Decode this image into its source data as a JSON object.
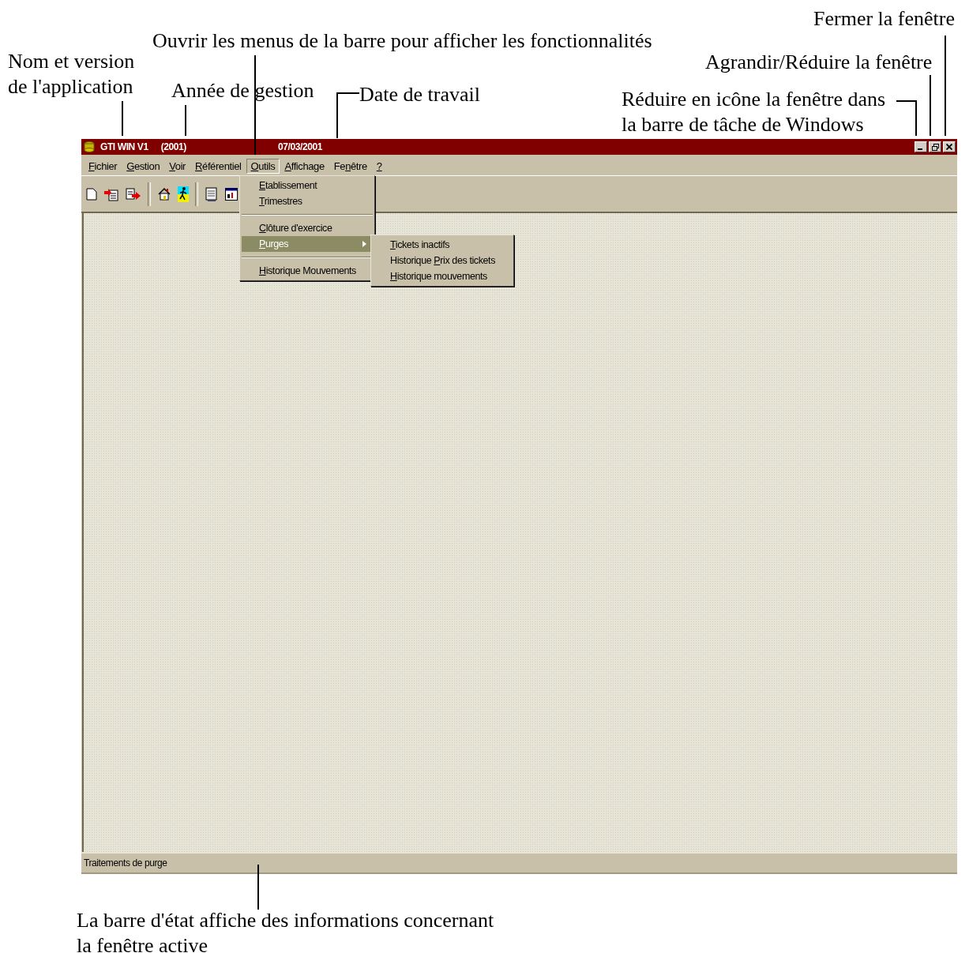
{
  "annotations": [
    {
      "text": "Nom et version\nde l'application"
    },
    {
      "text": "Ouvrir les menus de la barre pour afficher les fonctionnalités"
    },
    {
      "text": "Année de gestion"
    },
    {
      "text": "Date de travail"
    },
    {
      "text": "Fermer la fenêtre"
    },
    {
      "text": "Agrandir/Réduire la fenêtre"
    },
    {
      "text": "Réduire en icône la fenêtre dans\nla barre de tâche de Windows"
    },
    {
      "text": "La barre d'état affiche des informations concernant\nla fenêtre active"
    }
  ],
  "window": {
    "title": "GTI WIN V1",
    "year": "(2001)",
    "date": "07/03/2001"
  },
  "menu_bar": [
    {
      "key": "F",
      "after": "ichier",
      "selected": false
    },
    {
      "key": "G",
      "after": "estion",
      "selected": false
    },
    {
      "key": "V",
      "after": "oir",
      "selected": false
    },
    {
      "key": "R",
      "after": "éférentiel",
      "selected": false
    },
    {
      "key": "O",
      "after": "utils",
      "selected": true
    },
    {
      "key": "A",
      "after": "ffichage",
      "selected": false
    },
    {
      "before": "Fe",
      "key": "n",
      "after": "être",
      "selected": false
    },
    {
      "key": "?",
      "selected": false
    }
  ],
  "open_menu": {
    "items": [
      {
        "kind": "item",
        "key": "E",
        "after": "tablissement",
        "selected": false,
        "submenu": false
      },
      {
        "kind": "item",
        "key": "T",
        "after": "rimestres",
        "selected": false,
        "submenu": false
      },
      {
        "kind": "separator"
      },
      {
        "kind": "item",
        "key": "C",
        "after": "lôture d'exercice",
        "selected": false,
        "submenu": false
      },
      {
        "kind": "item",
        "key": "P",
        "after": "urges",
        "selected": true,
        "submenu": true
      },
      {
        "kind": "separator"
      },
      {
        "kind": "item",
        "key": "H",
        "after": "istorique Mouvements",
        "selected": false,
        "submenu": false
      }
    ]
  },
  "submenu": {
    "items": [
      {
        "kind": "item",
        "key": "T",
        "after": "ickets inactifs",
        "selected": false,
        "submenu": false
      },
      {
        "kind": "item",
        "before": "Historique ",
        "key": "P",
        "after": "rix des tickets",
        "selected": false,
        "submenu": false
      },
      {
        "kind": "item",
        "key": "H",
        "after": "istorique mouvements",
        "selected": false,
        "submenu": false
      }
    ]
  },
  "status_bar": {
    "text": "Traitements de purge"
  }
}
